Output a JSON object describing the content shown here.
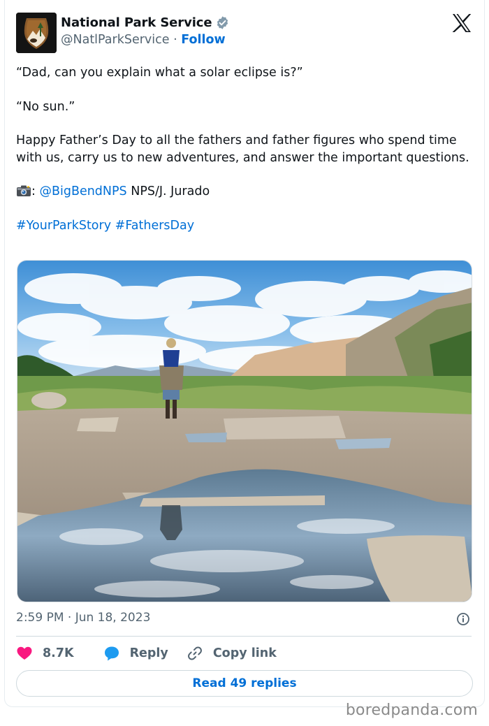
{
  "author": {
    "display_name": "National Park Service",
    "handle": "@NatlParkService",
    "separator": " · ",
    "follow_label": "Follow",
    "verified_color": "#829aab"
  },
  "tweet": {
    "line1": "“Dad, can you explain what a solar eclipse is?”",
    "line2": "“No sun.”",
    "line3": "Happy Father’s Day to all the fathers and father figures who spend time with us, carry us to new adventures, and answer the important questions.",
    "credit_prefix": ": ",
    "credit_mention": "@BigBendNPS",
    "credit_suffix": " NPS/J. Jurado",
    "hashtag1": "#YourParkStory",
    "hashtag2": "#FathersDay",
    "camera_icon": "camera-emoji-icon"
  },
  "meta": {
    "timestamp": "2:59 PM · Jun 18, 2023"
  },
  "actions": {
    "like_count": "8.7K",
    "reply_label": "Reply",
    "copy_link_label": "Copy link",
    "read_replies_label": "Read 49 replies"
  },
  "watermark": "boredpanda.com",
  "colors": {
    "link": "#006fd6",
    "heart": "#f91880",
    "reply_bubble": "#1d9bf0",
    "muted": "#536471"
  }
}
